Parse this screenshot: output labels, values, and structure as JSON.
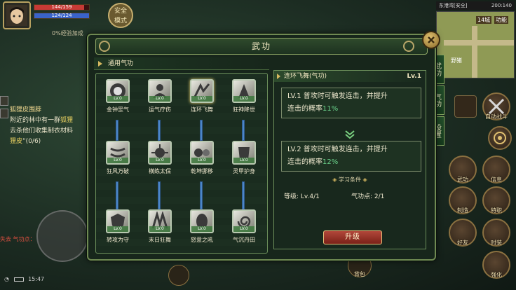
{
  "hud": {
    "hp_text": "144/159",
    "hp_fraction": 0.91,
    "mp_text": "124/124",
    "mp_fraction": 1.0,
    "safe_label_1": "安全",
    "safe_label_2": "模式",
    "exp_line": "0%经验加成"
  },
  "quest": {
    "title": "狐狸皮围脖",
    "line1": "附近的林中有一群",
    "line1_hl": "狐狸",
    "line2": "去杀他们收集制衣材料",
    "line3_hl": "狸皮",
    "line3_rest": "”(0/6)",
    "chat_notice": "失去 气功点："
  },
  "status_bar": {
    "time": "15:47"
  },
  "minimap": {
    "area": "东港湾[安全]",
    "coords": "200:140",
    "mark1": "14城",
    "mark2": "功能",
    "label": "野猪"
  },
  "side_tabs": [
    "武功",
    "气功",
    "设置"
  ],
  "right_buttons": {
    "auto_battle": "自动战斗",
    "wugong": "武功",
    "info": "信息",
    "craft": "制造",
    "special": "特职",
    "friends": "好友",
    "mall": "时装",
    "strengthen": "强化",
    "bag": "背包"
  },
  "dialog": {
    "title": "武功",
    "section_title": "通用气功",
    "skills": [
      {
        "name": "金钟罡气",
        "lv": "LV.0"
      },
      {
        "name": "运气疗伤",
        "lv": "LV.0"
      },
      {
        "name": "连环飞舞",
        "lv": "LV.0"
      },
      {
        "name": "狂神降世",
        "lv": "LV.0"
      },
      {
        "name": "狂风万破",
        "lv": "LV.0"
      },
      {
        "name": "横练太保",
        "lv": "LV.0"
      },
      {
        "name": "乾坤挪移",
        "lv": "LV.0"
      },
      {
        "name": "灵甲护身",
        "lv": "LV.0"
      },
      {
        "name": "转攻为守",
        "lv": "LV.0"
      },
      {
        "name": "末日狂舞",
        "lv": "LV.0"
      },
      {
        "name": "怒意之吼",
        "lv": "LV.0"
      },
      {
        "name": "气沉丹田",
        "lv": "LV.0"
      }
    ],
    "detail": {
      "name": "连环飞舞(气功)",
      "level": "Lv.1",
      "lv1_a": "LV.1 普攻时可触发连击，并提升",
      "lv1_b": "连击的概率",
      "lv1_pct": "11%",
      "lv2_a": "LV.2 普攻时可触发连击，并提升",
      "lv2_b": "连击的概率",
      "lv2_pct": "12%",
      "cond_title": "学习条件",
      "req_level": "等级: Lv.4/1",
      "req_points": "气功点: 2/1",
      "upgrade": "升级"
    }
  },
  "colors": {
    "panel_bg": "#17261b",
    "border": "#6f8a52",
    "highlight_green": "#6ad08a",
    "upgrade_red": "#9a3024"
  }
}
